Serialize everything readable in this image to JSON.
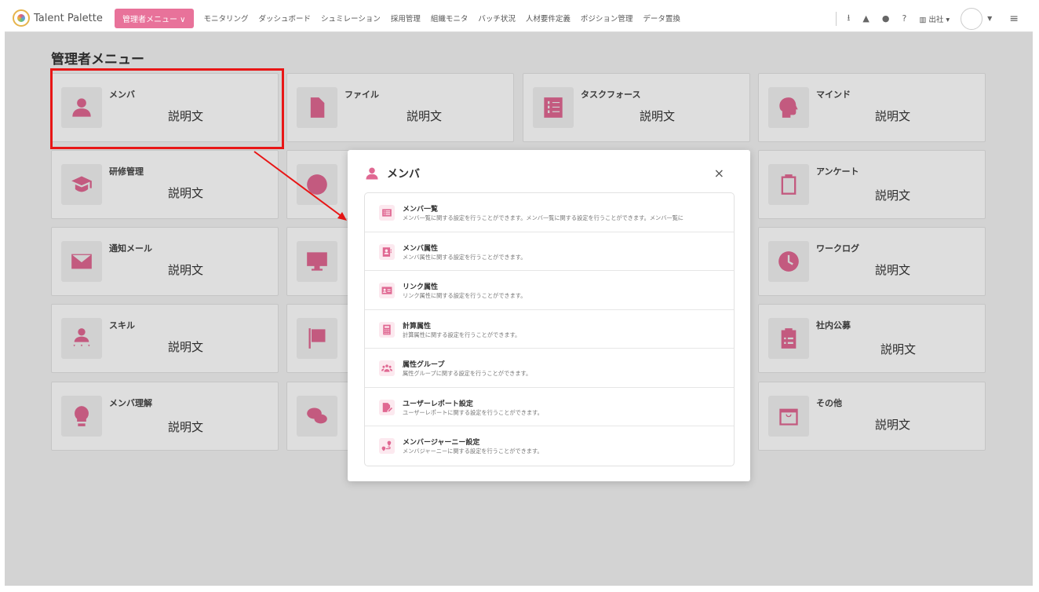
{
  "header": {
    "logo_text": "Talent Palette",
    "admin_menu_label": "管理者メニュー ∨",
    "nav": [
      "モニタリング",
      "ダッシュボード",
      "シュミレーション",
      "採用管理",
      "組織モニタ",
      "バッチ状況",
      "人材要件定義",
      "ポジション管理",
      "データ置換"
    ],
    "office_label": "出社 ▾",
    "icons": [
      "download-icon",
      "bell-icon",
      "chat-icon",
      "help-icon",
      "building-icon"
    ]
  },
  "page": {
    "title": "管理者メニュー"
  },
  "cards": [
    {
      "title": "メンバ",
      "desc": "説明文",
      "icon": "person-icon"
    },
    {
      "title": "ファイル",
      "desc": "説明文",
      "icon": "file-icon"
    },
    {
      "title": "タスクフォース",
      "desc": "説明文",
      "icon": "task-list-icon"
    },
    {
      "title": "マインド",
      "desc": "説明文",
      "icon": "mind-icon"
    },
    {
      "title": "研修管理",
      "desc": "説明文",
      "icon": "graduation-cap-icon"
    },
    {
      "title": "",
      "desc": "",
      "icon": "gift-icon"
    },
    {
      "title": "アンケート",
      "desc": "説明文",
      "icon": "survey-icon"
    },
    {
      "title": "通知メール",
      "desc": "説明文",
      "icon": "mail-icon"
    },
    {
      "title": "",
      "desc": "",
      "icon": "monitor-icon"
    },
    {
      "title": "ワークログ",
      "desc": "説明文",
      "icon": "clock-icon"
    },
    {
      "title": "スキル",
      "desc": "説明文",
      "icon": "skill-icon"
    },
    {
      "title": "",
      "desc": "",
      "icon": "flag-icon"
    },
    {
      "title": "社内公募",
      "desc": "説明文",
      "icon": "clipboard-icon"
    },
    {
      "title": "メンバ理解",
      "desc": "説明文",
      "icon": "lightbulb-icon"
    },
    {
      "title": "",
      "desc": "",
      "icon": "comments-icon"
    },
    {
      "title": "その他",
      "desc": "説明文",
      "icon": "bag-icon"
    }
  ],
  "modal": {
    "title": "メンバ",
    "close": "×",
    "items": [
      {
        "title": "メンバ一覧",
        "desc": "メンバ一覧に関する設定を行うことができます。メンバ一覧に関する設定を行うことができます。メンバ一覧に",
        "icon": "list-icon"
      },
      {
        "title": "メンバ属性",
        "desc": "メンバ属性に関する設定を行うことができます。",
        "icon": "id-card-icon"
      },
      {
        "title": "リンク属性",
        "desc": "リンク属性に関する設定を行うことができます。",
        "icon": "link-card-icon"
      },
      {
        "title": "計算属性",
        "desc": "計算属性に関する設定を行うことができます。",
        "icon": "calculator-icon"
      },
      {
        "title": "属性グループ",
        "desc": "属性グループに関する設定を行うことができます。",
        "icon": "group-icon"
      },
      {
        "title": "ユーザーレポート設定",
        "desc": "ユーザーレポートに関する設定を行うことができます。",
        "icon": "report-icon"
      },
      {
        "title": "メンバージャーニー設定",
        "desc": "メンバジャーニーに関する設定を行うことができます。",
        "icon": "route-icon"
      }
    ]
  },
  "colors": {
    "accent": "#e8729a",
    "icon": "#e06892",
    "highlight": "#e81616"
  }
}
